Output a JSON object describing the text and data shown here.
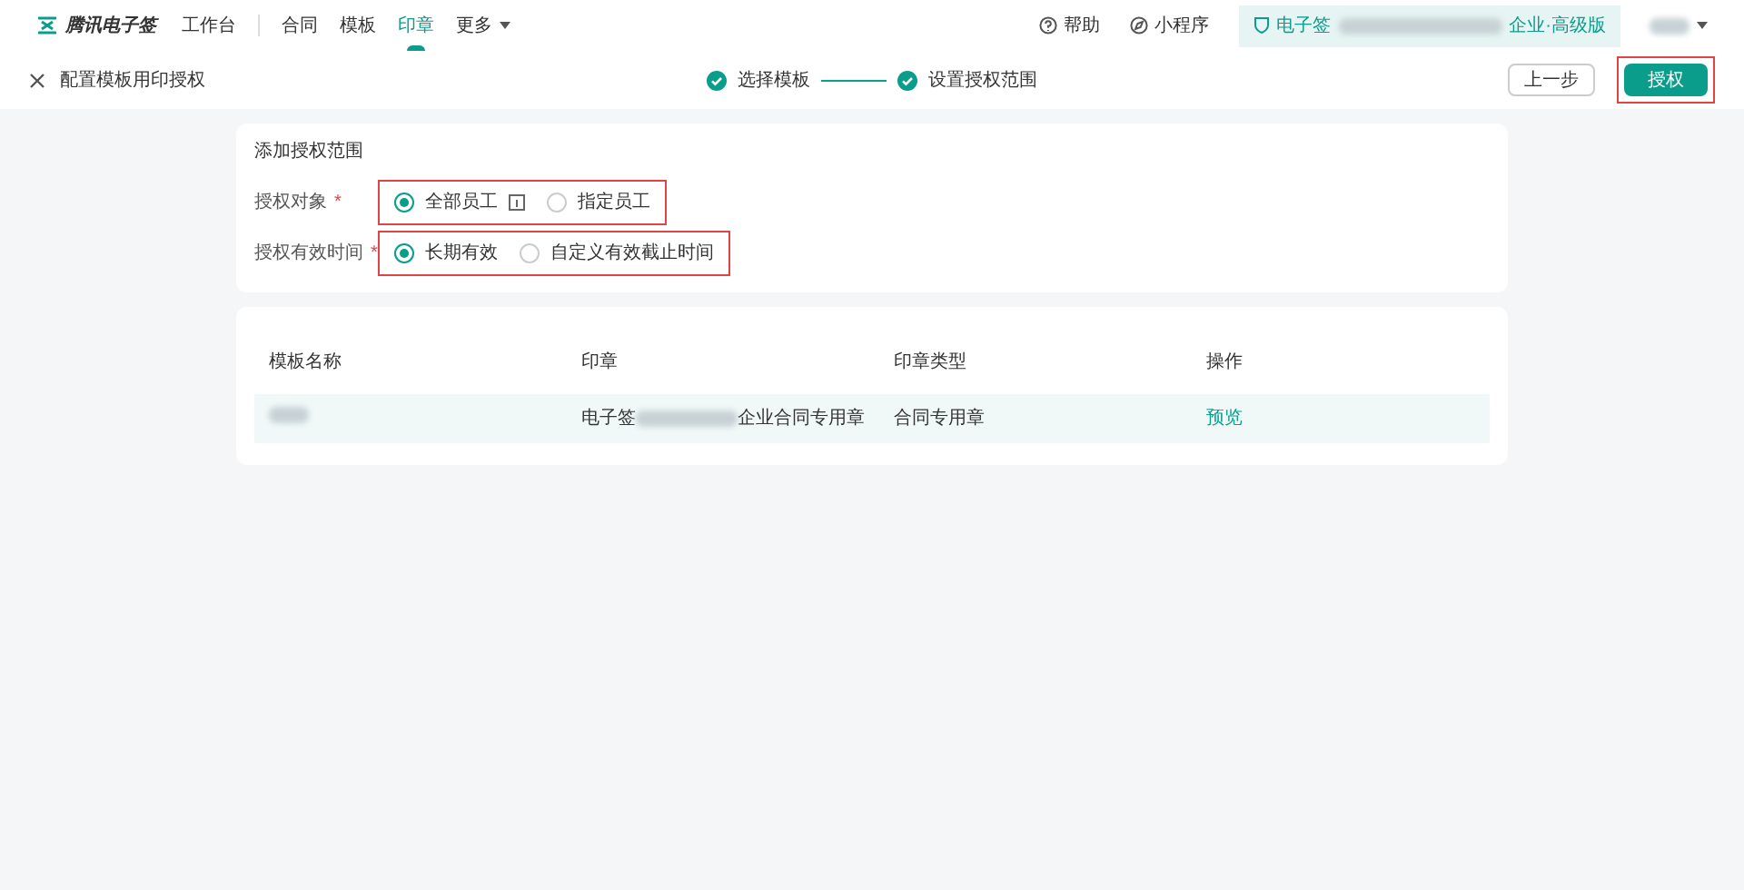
{
  "logo": {
    "text": "腾讯电子签"
  },
  "nav": [
    {
      "label": "工作台",
      "selected": false
    },
    {
      "label": "合同",
      "selected": false
    },
    {
      "label": "模板",
      "selected": false
    },
    {
      "label": "印章",
      "selected": true
    },
    {
      "label": "更多",
      "selected": false,
      "dropdown": true
    }
  ],
  "header_right": {
    "help": "帮助",
    "mini_program": "小程序",
    "org_prefix": "电子签",
    "org_suffix": "企业·高级版"
  },
  "subheader": {
    "title": "配置模板用印授权",
    "steps": [
      {
        "label": "选择模板",
        "done": true
      },
      {
        "label": "设置授权范围",
        "done": true
      }
    ],
    "back_button": "上一步",
    "submit_button": "授权"
  },
  "form": {
    "title": "添加授权范围",
    "fields": [
      {
        "label": "授权对象",
        "required_mark": "*",
        "highlighted": true,
        "options": [
          {
            "label": "全部员工",
            "selected": true,
            "info": true
          },
          {
            "label": "指定员工",
            "selected": false,
            "info": false
          }
        ]
      },
      {
        "label": "授权有效时间",
        "required_mark": "*",
        "highlighted": true,
        "options": [
          {
            "label": "长期有效",
            "selected": true,
            "info": false
          },
          {
            "label": "自定义有效截止时间",
            "selected": false,
            "info": false
          }
        ]
      }
    ]
  },
  "table": {
    "columns": [
      "模板名称",
      "印章",
      "印章类型",
      "操作"
    ],
    "rows": [
      {
        "seal_prefix": "电子签",
        "seal_suffix": "企业合同专用章",
        "seal_type": "合同专用章",
        "action": "预览",
        "selected": true
      }
    ]
  }
}
